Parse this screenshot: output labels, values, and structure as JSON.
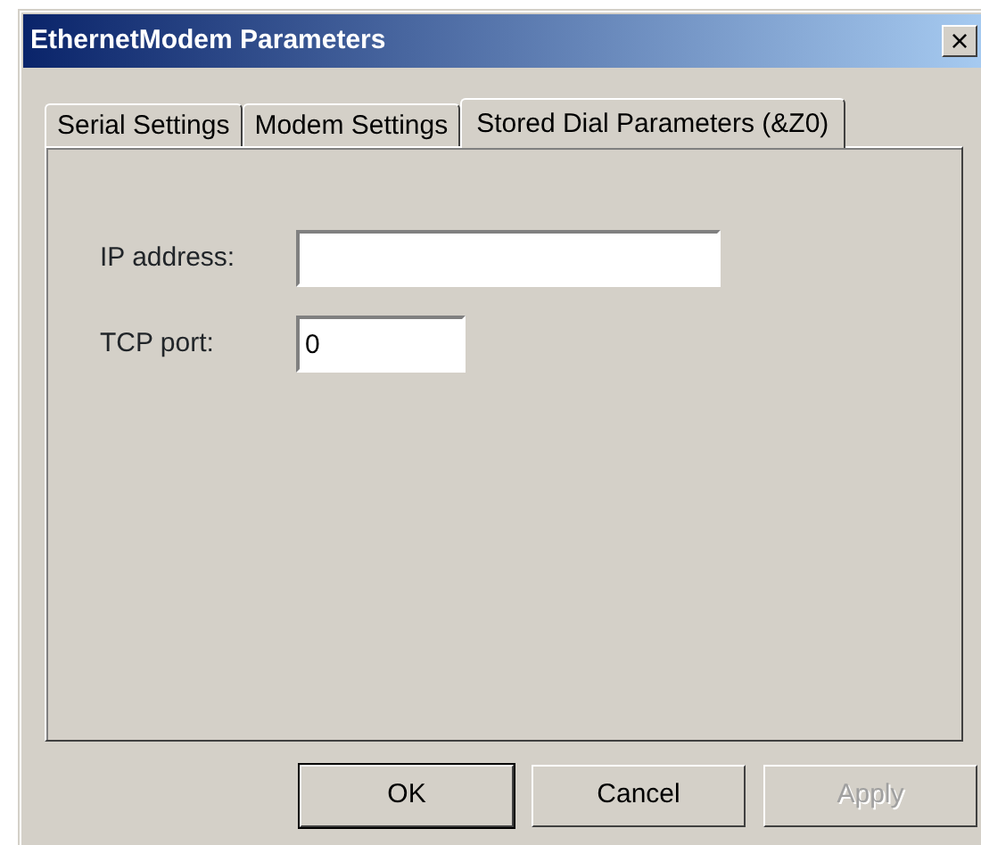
{
  "window": {
    "title": "EthernetModem Parameters",
    "close_glyph": "×"
  },
  "tabs": [
    {
      "label": "Serial Settings",
      "selected": false
    },
    {
      "label": "Modem Settings",
      "selected": false
    },
    {
      "label": "Stored Dial Parameters (&Z0)",
      "selected": true
    }
  ],
  "fields": [
    {
      "label": "IP address:",
      "wide": true
    },
    {
      "label": "TCP port:",
      "value": "0",
      "wide": false
    }
  ],
  "buttons": [
    {
      "label": "OK",
      "default": true,
      "disabled": false
    },
    {
      "label": "Cancel",
      "default": false,
      "disabled": false
    },
    {
      "label": "Apply",
      "default": false,
      "disabled": true
    }
  ]
}
